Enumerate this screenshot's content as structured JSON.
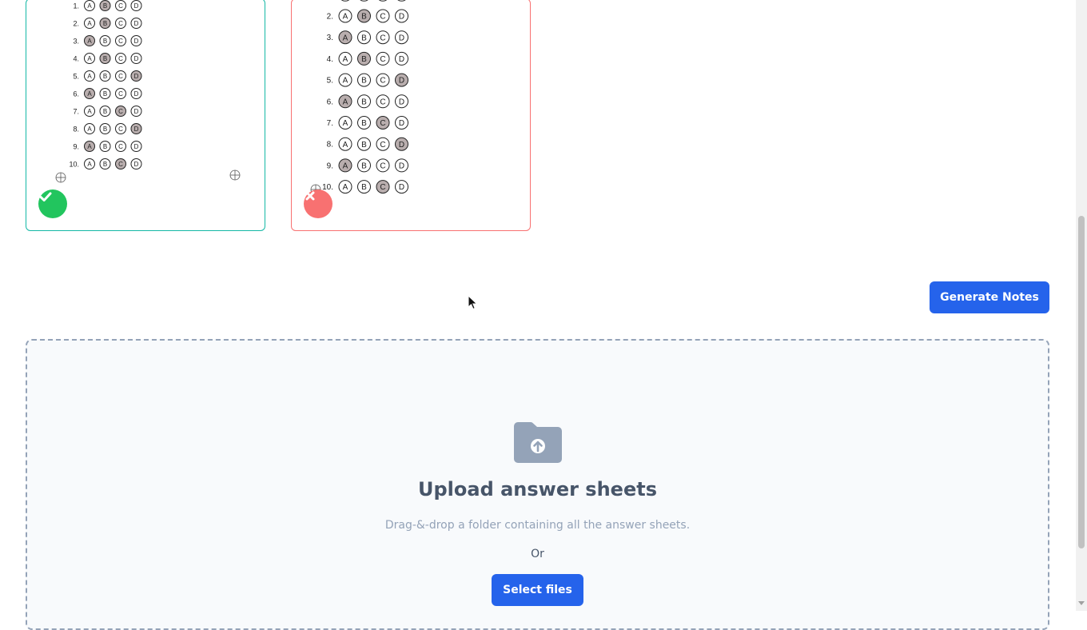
{
  "sheets": [
    {
      "status": "correct",
      "status_icon": "check-icon",
      "accent_color": "#14b8a6",
      "rows": [
        {
          "num": "1.",
          "marked": "B"
        },
        {
          "num": "2.",
          "marked": "B"
        },
        {
          "num": "3.",
          "marked": "A"
        },
        {
          "num": "4.",
          "marked": "B"
        },
        {
          "num": "5.",
          "marked": "D"
        },
        {
          "num": "6.",
          "marked": "A"
        },
        {
          "num": "7.",
          "marked": "C"
        },
        {
          "num": "8.",
          "marked": "D"
        },
        {
          "num": "9.",
          "marked": "A"
        },
        {
          "num": "10.",
          "marked": "C"
        }
      ]
    },
    {
      "status": "incorrect",
      "status_icon": "close-icon",
      "accent_color": "#f87171",
      "rows": [
        {
          "num": "2.",
          "marked": "B"
        },
        {
          "num": "3.",
          "marked": "A"
        },
        {
          "num": "4.",
          "marked": "B"
        },
        {
          "num": "5.",
          "marked": "D"
        },
        {
          "num": "6.",
          "marked": "A"
        },
        {
          "num": "7.",
          "marked": "C"
        },
        {
          "num": "8.",
          "marked": "D"
        },
        {
          "num": "9.",
          "marked": "A"
        },
        {
          "num": "10.",
          "marked": "C"
        }
      ]
    }
  ],
  "options": [
    "A",
    "B",
    "C",
    "D"
  ],
  "actions": {
    "generate_notes_label": "Generate Notes"
  },
  "upload": {
    "icon": "folder-upload-icon",
    "title": "Upload answer sheets",
    "subtitle": "Drag-&-drop a folder containing all the answer sheets.",
    "or_label": "Or",
    "select_files_label": "Select files"
  },
  "colors": {
    "primary": "#2563eb",
    "success": "#22c55e",
    "danger": "#f87171"
  }
}
